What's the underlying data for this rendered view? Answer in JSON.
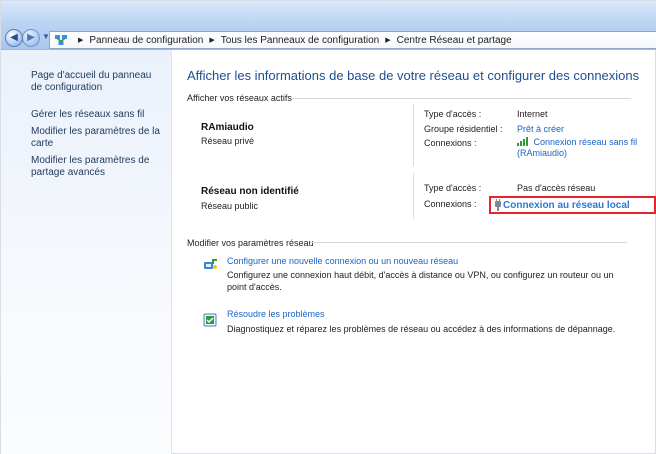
{
  "window": {
    "breadcrumb": [
      "Panneau de configuration",
      "Tous les Panneaux de configuration",
      "Centre Réseau et partage"
    ]
  },
  "sidebar": {
    "items": [
      "Page d'accueil du panneau de configuration",
      "Gérer les réseaux sans fil",
      "Modifier les paramètres de la carte",
      "Modifier les paramètres de partage avancés"
    ]
  },
  "main": {
    "title": "Afficher les informations de base de votre réseau et configurer des connexions",
    "active_networks_label": "Afficher vos réseaux actifs",
    "networks": [
      {
        "name": "RAmiaudio",
        "type": "Réseau privé",
        "access_label": "Type d'accès :",
        "access_value": "Internet",
        "homegroup_label": "Groupe résidentiel :",
        "homegroup_value": "Prêt à créer",
        "connections_label": "Connexions :",
        "connections_value": "Connexion réseau sans fil (RAmiaudio)"
      },
      {
        "name": "Réseau non identifié",
        "type": "Réseau public",
        "access_label": "Type d'accès :",
        "access_value": "Pas d'accès réseau",
        "connections_label": "Connexions :",
        "connections_value": "Connexion au réseau local"
      }
    ],
    "modify_settings_label": "Modifier vos paramètres réseau",
    "tasks": [
      {
        "title": "Configurer une nouvelle connexion ou un nouveau réseau",
        "description": "Configurez une connexion haut débit, d'accès à distance ou VPN, ou configurez un routeur ou un point d'accès."
      },
      {
        "title": "Résoudre les problèmes",
        "description": "Diagnostiquez et réparez les problèmes de réseau ou accédez à des informations de dépannage."
      }
    ]
  },
  "icons": {
    "back": "back-arrow-icon",
    "forward": "forward-arrow-icon",
    "history": "history-chevron-icon",
    "network_center": "network-center-icon",
    "wireless": "wireless-signal-icon",
    "local_connection": "ethernet-plug-icon",
    "new_connection": "new-connection-icon",
    "troubleshoot": "troubleshoot-icon"
  },
  "colors": {
    "title": "#1F4D92",
    "link": "#1B65C6",
    "highlight": "#E8212B"
  }
}
